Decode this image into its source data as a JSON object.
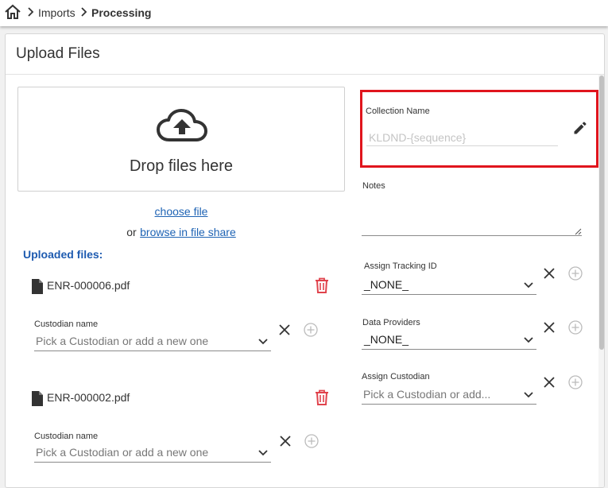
{
  "breadcrumb": {
    "home_icon": "home-icon",
    "items": [
      "Imports",
      "Processing"
    ]
  },
  "card": {
    "title": "Upload Files"
  },
  "dropzone": {
    "icon": "cloud-upload-icon",
    "text": "Drop files here",
    "choose_file": "choose file",
    "or": "or",
    "browse": "browse in file share"
  },
  "uploaded": {
    "label": "Uploaded files:",
    "files": [
      {
        "name": "ENR-000006.pdf",
        "custodian_label": "Custodian name",
        "custodian_placeholder": "Pick a Custodian or add a new one"
      },
      {
        "name": "ENR-000002.pdf",
        "custodian_label": "Custodian name",
        "custodian_placeholder": "Pick a Custodian or add a new one"
      }
    ]
  },
  "form": {
    "collection_name_label": "Collection Name",
    "collection_name_placeholder": "KLDND-{sequence}",
    "notes_label": "Notes",
    "tracking_label": "Assign Tracking ID",
    "tracking_value": "_NONE_",
    "providers_label": "Data Providers",
    "providers_value": "_NONE_",
    "custodian_label": "Assign Custodian",
    "custodian_placeholder": "Pick a Custodian or add..."
  },
  "colors": {
    "accent": "#1e63b4",
    "delete": "#e0434c",
    "highlight": "#e0151d"
  }
}
